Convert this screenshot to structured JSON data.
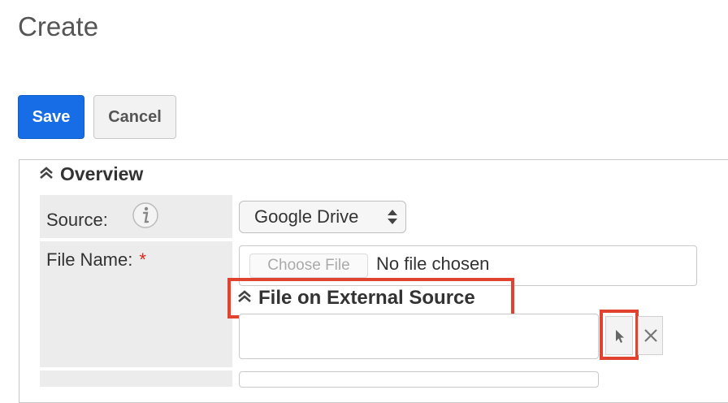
{
  "page": {
    "title": "Create"
  },
  "actions": {
    "save_label": "Save",
    "cancel_label": "Cancel"
  },
  "overview": {
    "title": "Overview",
    "source": {
      "label": "Source:",
      "value": "Google Drive"
    },
    "file_name": {
      "label": "File Name:",
      "required_marker": "*",
      "choose_file_label": "Choose File",
      "no_file_text": "No file chosen"
    },
    "external_source": {
      "title": "File on External Source",
      "value": ""
    }
  },
  "icons": {
    "info": "info-icon",
    "collapse": "double-chevron-up-icon",
    "select_arrows": "up-down-arrows-icon",
    "select_pointer": "cursor-arrow-icon",
    "clear": "close-icon"
  },
  "colors": {
    "primary": "#176de5",
    "highlight": "#e0432f",
    "required": "#d9261c"
  }
}
